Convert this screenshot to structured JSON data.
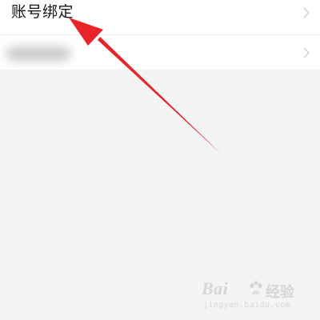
{
  "settings": {
    "rows": [
      {
        "label": "账号绑定"
      },
      {
        "label": ""
      }
    ]
  },
  "watermark": {
    "brand": "Bai",
    "paw": "du",
    "product": "经验",
    "url": "jingyan.baidu.com"
  },
  "colors": {
    "page_background": "#f4f4f4",
    "row_background": "#ffffff",
    "divider": "#ececec",
    "arrow": "#e8232a",
    "chevron": "#c9c9c9",
    "watermark": "#d6d6d6"
  },
  "icons": {
    "row_chevron": "chevron-right-icon",
    "annotation": "red-arrow-icon",
    "watermark_paw": "paw-icon"
  }
}
